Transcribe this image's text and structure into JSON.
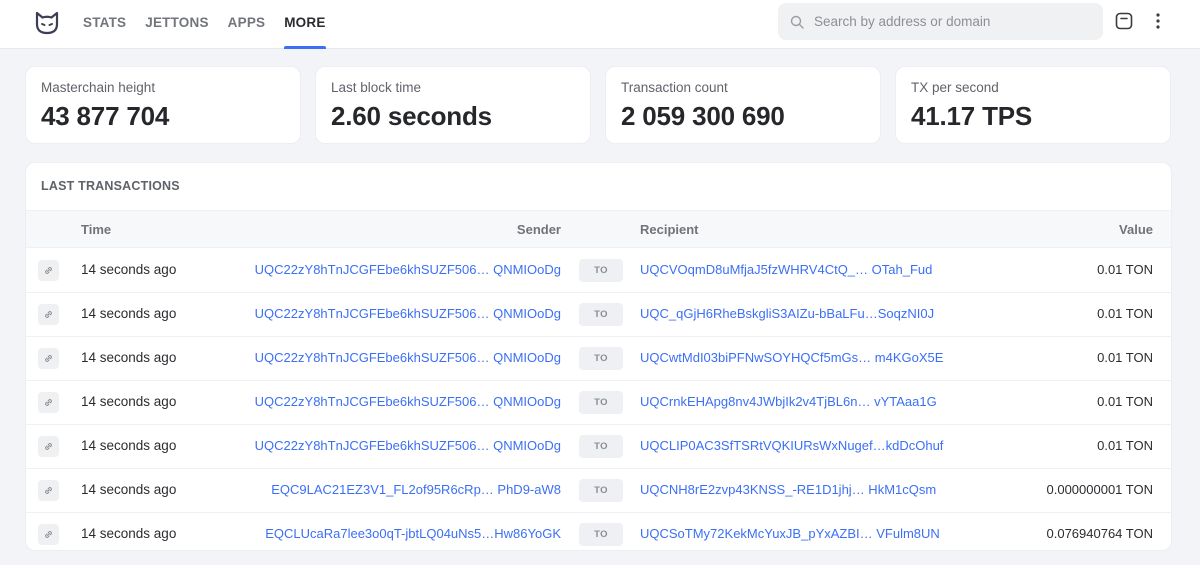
{
  "header": {
    "nav": [
      {
        "label": "STATS",
        "active": false
      },
      {
        "label": "JETTONS",
        "active": false
      },
      {
        "label": "APPS",
        "active": false
      },
      {
        "label": "MORE",
        "active": true
      }
    ],
    "search": {
      "placeholder": "Search by address or domain",
      "value": ""
    },
    "icons": {
      "logo": "cat-logo-icon",
      "search": "search-icon",
      "theme": "theme-toggle-icon",
      "menu": "more-vertical-icon"
    }
  },
  "stats": [
    {
      "label": "Masterchain height",
      "value": "43 877 704"
    },
    {
      "label": "Last block time",
      "value": "2.60 seconds"
    },
    {
      "label": "Transaction count",
      "value": "2 059 300 690"
    },
    {
      "label": "TX per second",
      "value": "41.17 TPS"
    }
  ],
  "transactions": {
    "title": "LAST TRANSACTIONS",
    "columns": {
      "time": "Time",
      "sender": "Sender",
      "recipient": "Recipient",
      "value": "Value"
    },
    "direction_label": "TO",
    "rows": [
      {
        "time": "14 seconds ago",
        "sender": "UQC22zY8hTnJCGFEbe6khSUZF506… QNMIOoDg",
        "recipient": "UQCVOqmD8uMfjaJ5fzWHRV4CtQ_…  OTah_Fud",
        "value": "0.01 TON"
      },
      {
        "time": "14 seconds ago",
        "sender": "UQC22zY8hTnJCGFEbe6khSUZF506… QNMIOoDg",
        "recipient": "UQC_qGjH6RheBskgliS3AIZu-bBaLFu…SoqzNI0J",
        "value": "0.01 TON"
      },
      {
        "time": "14 seconds ago",
        "sender": "UQC22zY8hTnJCGFEbe6khSUZF506… QNMIOoDg",
        "recipient": "UQCwtMdI03biPFNwSOYHQCf5mGs… m4KGoX5E",
        "value": "0.01 TON"
      },
      {
        "time": "14 seconds ago",
        "sender": "UQC22zY8hTnJCGFEbe6khSUZF506… QNMIOoDg",
        "recipient": "UQCrnkEHApg8nv4JWbjIk2v4TjBL6n… vYTAaa1G",
        "value": "0.01 TON"
      },
      {
        "time": "14 seconds ago",
        "sender": "UQC22zY8hTnJCGFEbe6khSUZF506… QNMIOoDg",
        "recipient": "UQCLIP0AC3SfTSRtVQKIURsWxNugef…kdDcOhuf",
        "value": "0.01 TON"
      },
      {
        "time": "14 seconds ago",
        "sender": "EQC9LAC21EZ3V1_FL2of95R6cRp…  PhD9-aW8",
        "recipient": "UQCNH8rE2zvp43KNSS_-RE1D1jhj… HkM1cQsm",
        "value": "0.000000001 TON"
      },
      {
        "time": "14 seconds ago",
        "sender": "EQCLUcaRa7lee3o0qT-jbtLQ04uNs5…Hw86YoGK",
        "recipient": "UQCSoTMy72KekMcYuxJB_pYxAZBI… VFulm8UN",
        "value": "0.076940764 TON"
      }
    ]
  }
}
